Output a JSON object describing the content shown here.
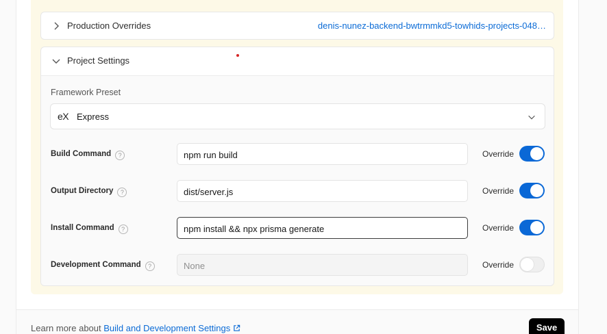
{
  "colors": {
    "accent": "#0a68d6",
    "link": "#0b6bd6",
    "warning_bg": "#fdf9e7"
  },
  "production_overrides": {
    "label": "Production Overrides",
    "value": "denis-nunez-backend-bwtrmmkd5-towhids-projects-048…"
  },
  "project_settings": {
    "label": "Project Settings",
    "framework_preset": {
      "label": "Framework Preset",
      "icon": "express-logo-icon",
      "logo_text": "eX",
      "selected": "Express"
    },
    "rows": [
      {
        "label": "Build Command",
        "value": "npm run build",
        "placeholder": "",
        "override_label": "Override",
        "override": true
      },
      {
        "label": "Output Directory",
        "value": "dist/server.js",
        "placeholder": "",
        "override_label": "Override",
        "override": true
      },
      {
        "label": "Install Command",
        "value": "npm install && npx prisma generate",
        "placeholder": "",
        "override_label": "Override",
        "override": true
      },
      {
        "label": "Development Command",
        "value": "",
        "placeholder": "None",
        "override_label": "Override",
        "override": false
      }
    ],
    "help_glyph": "?"
  },
  "footer": {
    "text": "Learn more about",
    "link_label": "Build and Development Settings",
    "save_label": "Save"
  }
}
